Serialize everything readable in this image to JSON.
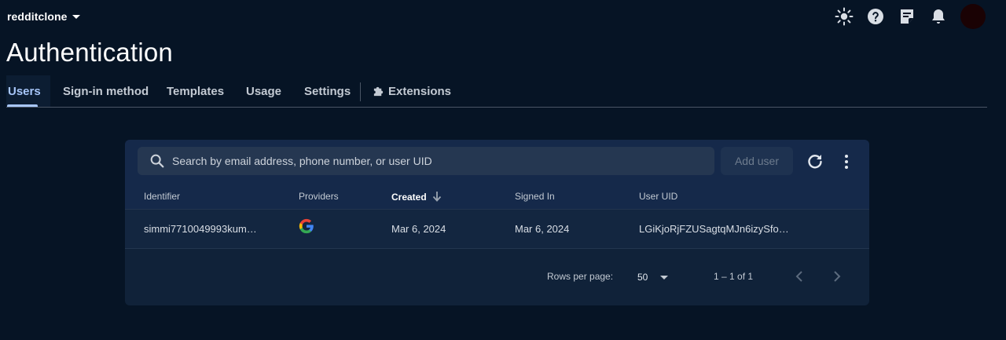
{
  "header": {
    "project_name": "redditclone",
    "icons": [
      "brightness-icon",
      "help-icon",
      "notes-icon",
      "notifications-icon",
      "avatar"
    ]
  },
  "page": {
    "title": "Authentication"
  },
  "tabs": [
    {
      "label": "Users",
      "active": true
    },
    {
      "label": "Sign-in method"
    },
    {
      "label": "Templates"
    },
    {
      "label": "Usage"
    },
    {
      "label": "Settings"
    },
    {
      "label": "Extensions",
      "icon": "extensions-icon"
    }
  ],
  "toolbar": {
    "search_placeholder": "Search by email address, phone number, or user UID",
    "add_user_label": "Add user"
  },
  "table": {
    "columns": [
      "Identifier",
      "Providers",
      "Created",
      "Signed In",
      "User UID"
    ],
    "sorted_column": "Created",
    "rows": [
      {
        "identifier": "simmi7710049993kum…",
        "provider": "google-icon",
        "created": "Mar 6, 2024",
        "signed_in": "Mar 6, 2024",
        "uid": "LGiKjoRjFZUSagtqMJn6izySfo…"
      }
    ]
  },
  "pagination": {
    "rows_per_page_label": "Rows per page:",
    "rows_per_page_value": "50",
    "range": "1 – 1 of 1"
  },
  "colors": {
    "background": "#061425",
    "card": "#102239",
    "accent": "#a8c7fa"
  }
}
